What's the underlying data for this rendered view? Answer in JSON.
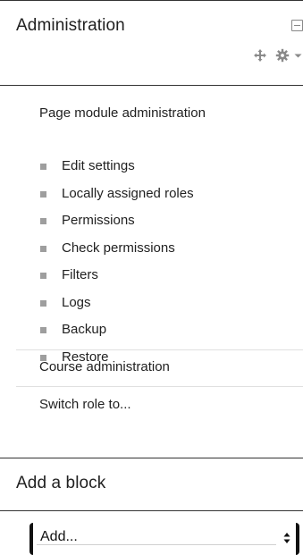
{
  "admin_block": {
    "title": "Administration",
    "controls": {
      "collapse_icon": "collapse-icon",
      "move_icon": "move-icon",
      "actions_icon": "gear-icon",
      "dropdown_icon": "caret-down-icon"
    },
    "page_module": {
      "heading": "Page module administration",
      "items": [
        {
          "label": "Edit settings"
        },
        {
          "label": "Locally assigned roles"
        },
        {
          "label": "Permissions"
        },
        {
          "label": "Check permissions"
        },
        {
          "label": "Filters"
        },
        {
          "label": "Logs"
        },
        {
          "label": "Backup"
        },
        {
          "label": "Restore"
        }
      ]
    },
    "course_admin": {
      "label": "Course administration"
    },
    "switch_role": {
      "label": "Switch role to..."
    }
  },
  "add_block": {
    "title": "Add a block",
    "select": {
      "value": "Add..."
    }
  },
  "colors": {
    "text": "#212121",
    "bullet": "#9e9e9e",
    "rule": "#333333",
    "divider": "#e0e0e0"
  }
}
